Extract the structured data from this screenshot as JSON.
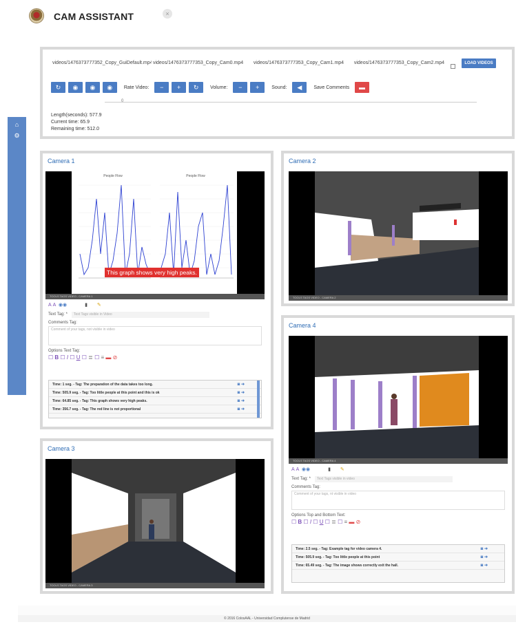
{
  "app": {
    "title": "CAM ASSISTANT",
    "close_glyph": "×"
  },
  "sidebar": {
    "items": [
      {
        "icon": "home-icon",
        "glyph": "⌂"
      },
      {
        "icon": "gears-icon",
        "glyph": "⚙"
      }
    ]
  },
  "controls": {
    "files": [
      "videos/1476373777352_Copy_GuiDefault.mp4",
      "videos/1476373777353_Copy_Cam0.mp4",
      "videos/1476373777353_Copy_Cam1.mp4",
      "videos/1476373777353_Copy_Cam2.mp4"
    ],
    "load_label": "LOAD VIDEOS",
    "rate_label": "Rate Video:",
    "volume_label": "Volume:",
    "sound_label": "Sound:",
    "save_comments_label": "Save Comments",
    "slider_value": "0",
    "length": "Length(seconds): 577.9",
    "current": "Current time: 65.9",
    "remaining": "Remaining time: 512.0"
  },
  "cameras": {
    "cam1": {
      "title": "Camera 1",
      "chart_left_title": "People Flow",
      "chart_right_title": "People Flow",
      "overlay": "This graph shows very high peaks.",
      "toolsbar": "TOOLS TAGS VIDEO - CAMERA 1",
      "text_tag_label": "Text Tag: *",
      "text_tag_placeholder": "Text Tags visible in Video",
      "comments_label": "Comments Tag:",
      "comments_placeholder": "Comment of your tags, not visible in video",
      "options_label": "Options Text Tag:",
      "tags": [
        "Time: 1 seg. - Tag: The preparation of the data takes too long.",
        "Time: 505.9 seg. - Tag: Too little people at this point and this is ok",
        "Time: 64.85 seg. - Tag: This graph shows very high peaks.",
        "Time: 356.7 seg. - Tag: The red line is not proportional"
      ]
    },
    "cam2": {
      "title": "Camera 2",
      "toolsbar": "TOOLS TAGS VIDEO - CAMERA 2"
    },
    "cam3": {
      "title": "Camera 3",
      "toolsbar": "TOOLS TAGS VIDEO - CAMERA 3"
    },
    "cam4": {
      "title": "Camera 4",
      "toolsbar": "TOOLS TAGS VIDEO - CAMERA 4",
      "text_tag_label": "Text Tag: *",
      "text_tag_placeholder": "Text Tags visible in video",
      "comments_label": "Comments Tag:",
      "comments_placeholder": "Comment of your tags, nt visible in video",
      "options_label": "Options Top and Bottom Text:",
      "tags": [
        "Time: 2.5 seg. - Tag: Example tag for video camera 4.",
        "Time: 505.9 seg. - Tag: Too little people at this point",
        "Time: 65.49 seg. - Tag: The image shows correctly exit the hall."
      ]
    }
  },
  "footer": {
    "text": "© 2016 ColosAAL - Universidad Complutense de Madrid"
  },
  "colors": {
    "accent": "#4a7cc4",
    "title_blue": "#2f6db5",
    "sidebar": "#5b87c7"
  }
}
